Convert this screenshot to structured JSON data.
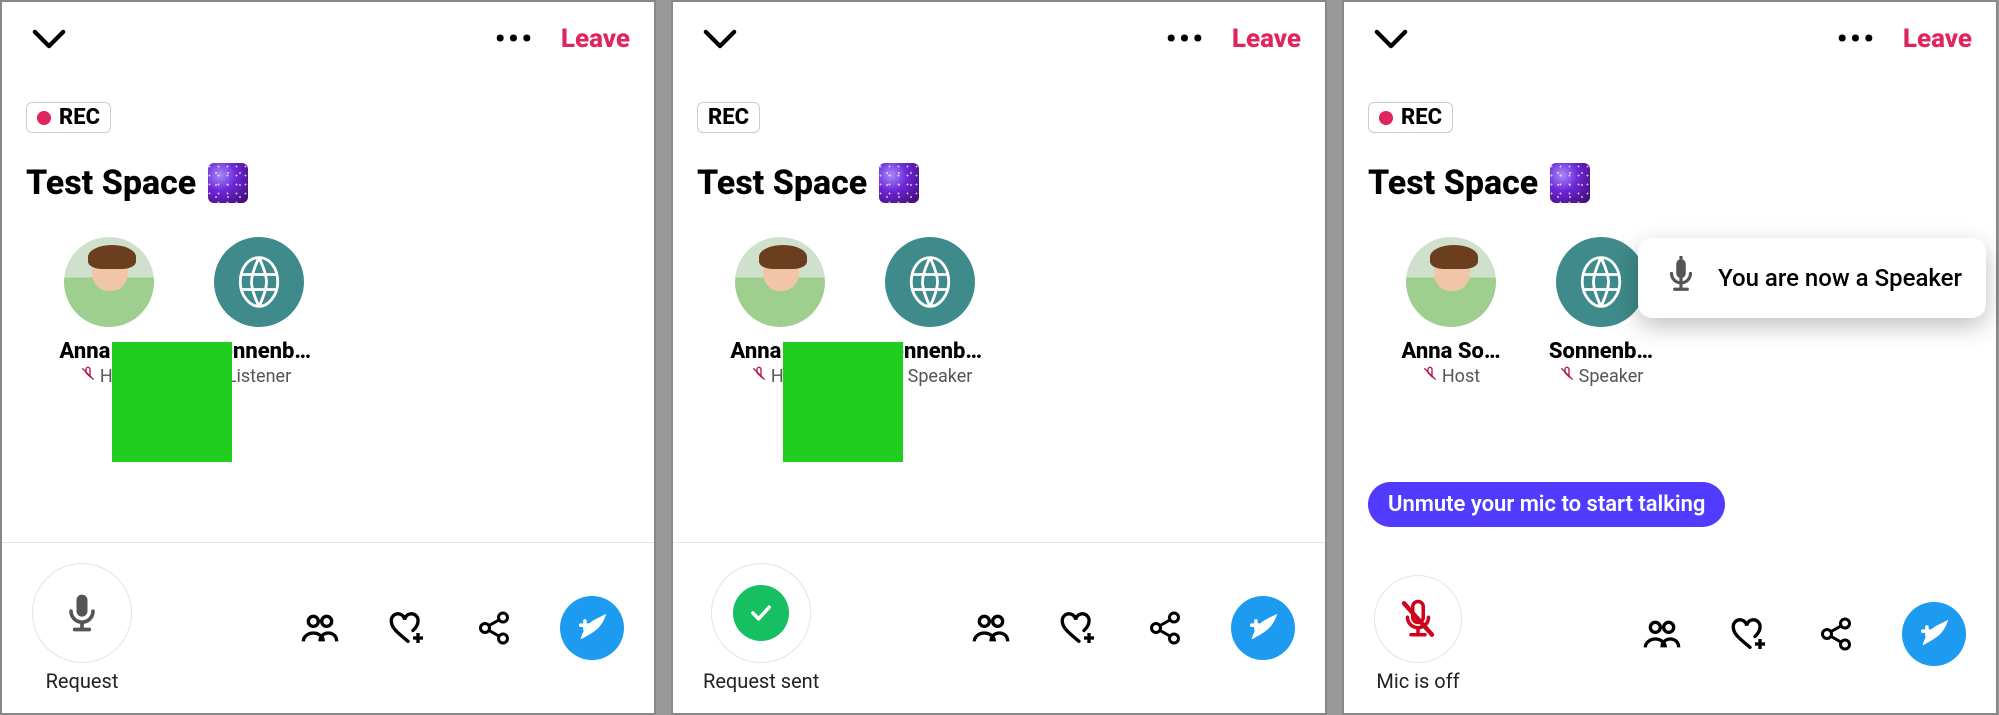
{
  "screens": [
    {
      "header": {
        "leave": "Leave"
      },
      "rec": {
        "label": "REC",
        "live": true
      },
      "title": "Test Space",
      "participants": [
        {
          "name": "Anna So…",
          "role": "Host",
          "muted": true,
          "avatar": "photo"
        },
        {
          "name": "Sonnenb…",
          "role": "Listener",
          "muted": false,
          "avatar": "teal"
        }
      ],
      "primary": {
        "label": "Request",
        "kind": "mic"
      }
    },
    {
      "header": {
        "leave": "Leave"
      },
      "rec": {
        "label": "REC",
        "live": false
      },
      "title": "Test Space",
      "participants": [
        {
          "name": "Anna So…",
          "role": "Host",
          "muted": true,
          "avatar": "photo"
        },
        {
          "name": "Sonnenb…",
          "role": "Speaker",
          "muted": true,
          "avatar": "teal"
        }
      ],
      "primary": {
        "label": "Request sent",
        "kind": "check"
      }
    },
    {
      "header": {
        "leave": "Leave"
      },
      "rec": {
        "label": "REC",
        "live": true
      },
      "title": "Test Space",
      "participants": [
        {
          "name": "Anna So…",
          "role": "Host",
          "muted": true,
          "avatar": "photo"
        },
        {
          "name": "Sonnenb…",
          "role": "Speaker",
          "muted": true,
          "avatar": "teal"
        }
      ],
      "toast": "You are now a Speaker",
      "tooltip": "Unmute your mic to start talking",
      "primary": {
        "label": "Mic is off",
        "kind": "mic-off"
      }
    }
  ]
}
